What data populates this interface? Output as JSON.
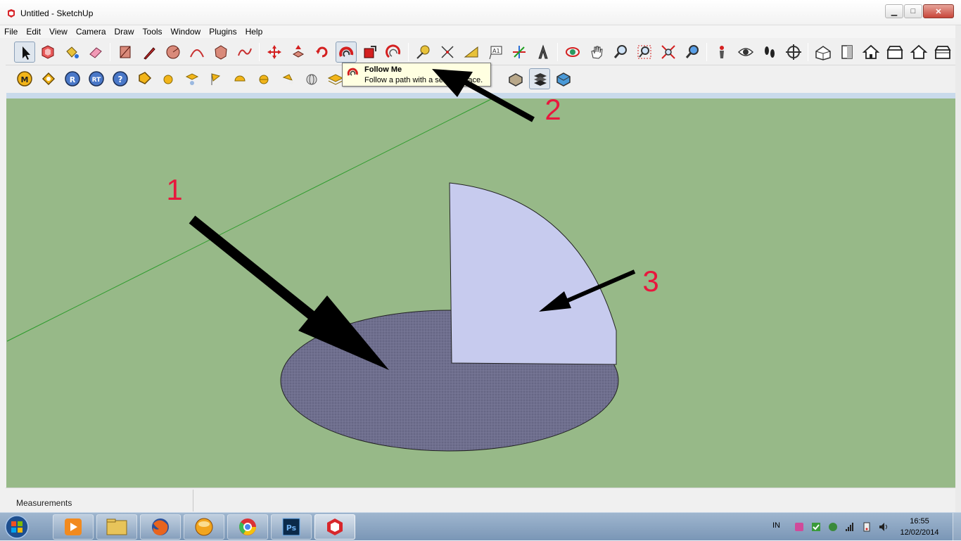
{
  "window": {
    "title": "Untitled - SketchUp",
    "controls": {
      "minimize": "▁",
      "maximize": "□",
      "close": "✕"
    }
  },
  "menu": [
    "File",
    "Edit",
    "View",
    "Camera",
    "Draw",
    "Tools",
    "Window",
    "Plugins",
    "Help"
  ],
  "toolbar_main": [
    "select-tool",
    "make-component-tool",
    "paint-bucket-tool",
    "eraser-tool",
    "rectangle-tool",
    "line-tool",
    "circle-tool",
    "arc-tool",
    "polygon-tool",
    "freehand-tool",
    "move-tool",
    "push-pull-tool",
    "rotate-tool",
    "follow-me-tool",
    "scale-tool",
    "offset-tool",
    "tape-measure-tool",
    "dimension-tool",
    "protractor-tool",
    "text-tool",
    "axes-tool",
    "3d-text-tool",
    "orbit-tool",
    "pan-tool",
    "zoom-tool",
    "zoom-window-tool",
    "zoom-extents-tool",
    "previous-view-tool",
    "position-camera-tool",
    "look-around-tool",
    "walk-tool",
    "section-plane-tool",
    "iso-view",
    "top-view",
    "front-view",
    "right-view",
    "back-view",
    "left-view"
  ],
  "toolbar_plugins": [
    "M",
    "",
    "R",
    "RT",
    "?",
    "",
    "",
    "",
    "",
    "",
    "",
    "",
    "",
    ""
  ],
  "tooltip": {
    "title": "Follow Me",
    "description": "Follow a path with a selected face."
  },
  "annotations": [
    {
      "label": "1",
      "color": "#e8173d"
    },
    {
      "label": "2",
      "color": "#e8173d"
    },
    {
      "label": "3",
      "color": "#e8173d"
    }
  ],
  "statusbar": {
    "measurements_label": "Measurements"
  },
  "taskbar": {
    "apps": [
      "windows-media-player",
      "windows-explorer",
      "firefox",
      "gnome-app",
      "chrome",
      "photoshop",
      "sketchup"
    ],
    "language": "IN",
    "time": "16:55",
    "date": "12/02/2014"
  },
  "colors": {
    "viewport_green": "#97b988",
    "disk_face": "#6f6f8e",
    "profile_face": "#c7cbee",
    "annotation_red": "#e8173d"
  }
}
